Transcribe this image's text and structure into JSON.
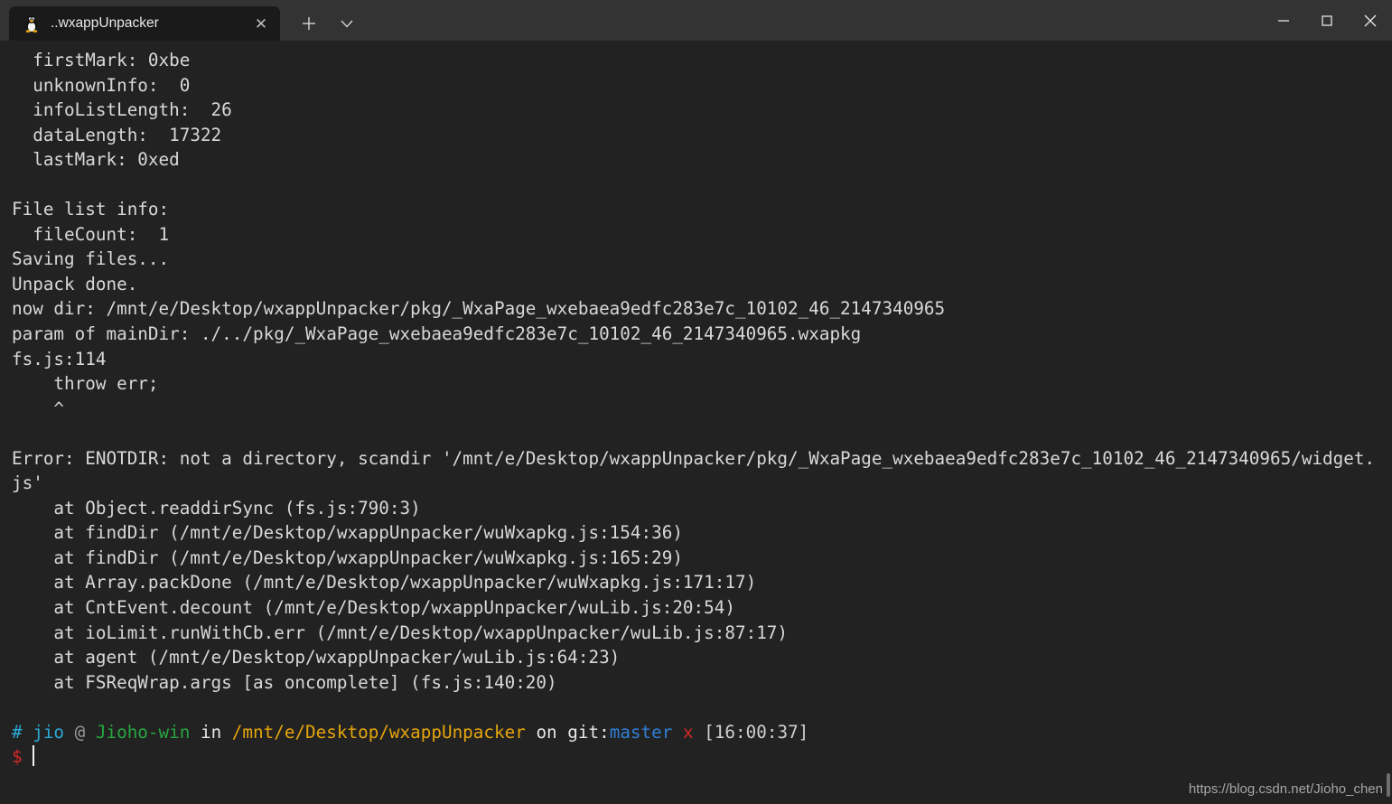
{
  "window": {
    "tab": {
      "title": "..wxappUnpacker",
      "icon": "tux-linux-icon",
      "close_label": "✕"
    },
    "new_tab_label": "+",
    "tab_dropdown_label": "˅",
    "controls": {
      "minimize": "—",
      "maximize": "□",
      "close": "✕"
    }
  },
  "colors": {
    "titlebar_bg": "#333333",
    "tab_bg": "#1a1a1a",
    "terminal_bg": "#222222",
    "foreground": "#d8d8d8",
    "cyan": "#2ba8d4",
    "green": "#26a641",
    "yellow": "#e5a50a",
    "blue": "#2f7fd6",
    "red": "#d62828",
    "grey": "#9a9a9a"
  },
  "terminal": {
    "lines": [
      "  firstMark: 0xbe",
      "  unknownInfo:  0",
      "  infoListLength:  26",
      "  dataLength:  17322",
      "  lastMark: 0xed",
      "",
      "File list info:",
      "  fileCount:  1",
      "Saving files...",
      "Unpack done.",
      "now dir: /mnt/e/Desktop/wxappUnpacker/pkg/_WxaPage_wxebaea9edfc283e7c_10102_46_2147340965",
      "param of mainDir: ./../pkg/_WxaPage_wxebaea9edfc283e7c_10102_46_2147340965.wxapkg",
      "fs.js:114",
      "    throw err;",
      "    ^",
      "",
      "Error: ENOTDIR: not a directory, scandir '/mnt/e/Desktop/wxappUnpacker/pkg/_WxaPage_wxebaea9edfc283e7c_10102_46_2147340965/widget.js'",
      "    at Object.readdirSync (fs.js:790:3)",
      "    at findDir (/mnt/e/Desktop/wxappUnpacker/wuWxapkg.js:154:36)",
      "    at findDir (/mnt/e/Desktop/wxappUnpacker/wuWxapkg.js:165:29)",
      "    at Array.packDone (/mnt/e/Desktop/wxappUnpacker/wuWxapkg.js:171:17)",
      "    at CntEvent.decount (/mnt/e/Desktop/wxappUnpacker/wuLib.js:20:54)",
      "    at ioLimit.runWithCb.err (/mnt/e/Desktop/wxappUnpacker/wuLib.js:87:17)",
      "    at agent (/mnt/e/Desktop/wxappUnpacker/wuLib.js:64:23)",
      "    at FSReqWrap.args [as oncomplete] (fs.js:140:20)",
      ""
    ],
    "wrapped_error_line_index": 16,
    "prompt": {
      "hash": "#",
      "user": "jio",
      "at": "@",
      "host": "Jioho-win",
      "in": "in",
      "path": "/mnt/e/Desktop/wxappUnpacker",
      "on": "on",
      "git_label": "git:",
      "branch": "master",
      "dirty_mark": "x",
      "time": "[16:00:37]",
      "symbol": "$",
      "input": ""
    }
  },
  "watermark": "https://blog.csdn.net/Jioho_chen"
}
